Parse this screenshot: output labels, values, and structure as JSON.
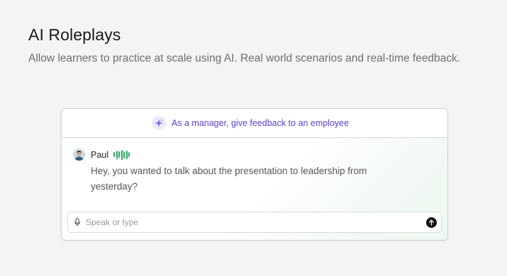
{
  "heading": {
    "title": "AI Roleplays",
    "subtitle": "Allow learners to practice at scale using AI. Real world scenarios and real-time feedback."
  },
  "roleplay": {
    "scenario_icon": "sparkle-icon",
    "scenario": "As a manager, give feedback to an employee",
    "message": {
      "speaker": "Paul",
      "speaking_indicator": "audio-wave-icon",
      "text": "Hey, you wanted to talk about the presentation to leadership from yesterday?"
    },
    "composer": {
      "mic_icon": "microphone-icon",
      "placeholder": "Speak or type",
      "value": "",
      "send_icon": "send-arrow-icon"
    }
  },
  "colors": {
    "accent": "#5a3fd6",
    "wave": "#2fa866",
    "page_bg": "#f4f4f2"
  }
}
